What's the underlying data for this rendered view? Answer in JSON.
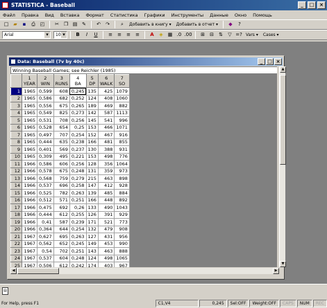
{
  "app": {
    "title": "STATISTICA - Baseball"
  },
  "menu": [
    "Файл",
    "Правка",
    "Вид",
    "Вставка",
    "Формат",
    "Статистика",
    "Графики",
    "Инструменты",
    "Данные",
    "Окно",
    "Помощь"
  ],
  "toolbar1": {
    "add_workbook": "Добавить в книгу ▾",
    "add_report": "Добавить в отчет ▾"
  },
  "toolbar2": {
    "font": "Arial",
    "size": "10",
    "vars": "Vars ▾",
    "cases": "Cases ▾"
  },
  "sheet": {
    "title": "Data: Baseball (7v by 40c)",
    "caption": "Winning Baseball Games; see Reichler (1985)",
    "columns": [
      {
        "num": "1",
        "name": "YEAR"
      },
      {
        "num": "2",
        "name": "WIN"
      },
      {
        "num": "3",
        "name": "RUNS"
      },
      {
        "num": "4",
        "name": "BA"
      },
      {
        "num": "5",
        "name": "DP"
      },
      {
        "num": "6",
        "name": "WALK"
      },
      {
        "num": "7",
        "name": "SO"
      }
    ],
    "rows": [
      [
        "1",
        "1965",
        "0,599",
        "608",
        "0,245",
        "135",
        "425",
        "1079"
      ],
      [
        "2",
        "1965",
        "0,586",
        "682",
        "0,252",
        "124",
        "408",
        "1060"
      ],
      [
        "3",
        "1965",
        "0,556",
        "675",
        "0,265",
        "189",
        "469",
        "882"
      ],
      [
        "4",
        "1965",
        "0,549",
        "825",
        "0,273",
        "142",
        "587",
        "1113"
      ],
      [
        "5",
        "1965",
        "0,531",
        "708",
        "0,256",
        "145",
        "541",
        "996"
      ],
      [
        "6",
        "1965",
        "0,528",
        "654",
        "0,25",
        "153",
        "466",
        "1071"
      ],
      [
        "7",
        "1965",
        "0,497",
        "707",
        "0,254",
        "152",
        "467",
        "916"
      ],
      [
        "8",
        "1965",
        "0,444",
        "635",
        "0,238",
        "166",
        "481",
        "855"
      ],
      [
        "9",
        "1965",
        "0,401",
        "569",
        "0,237",
        "130",
        "388",
        "931"
      ],
      [
        "10",
        "1965",
        "0,309",
        "495",
        "0,221",
        "153",
        "498",
        "776"
      ],
      [
        "11",
        "1966",
        "0,586",
        "606",
        "0,256",
        "128",
        "356",
        "1064"
      ],
      [
        "12",
        "1966",
        "0,578",
        "675",
        "0,248",
        "131",
        "359",
        "973"
      ],
      [
        "13",
        "1966",
        "0,568",
        "759",
        "0,279",
        "215",
        "463",
        "898"
      ],
      [
        "14",
        "1966",
        "0,537",
        "696",
        "0,258",
        "147",
        "412",
        "928"
      ],
      [
        "15",
        "1966",
        "0,525",
        "782",
        "0,263",
        "139",
        "485",
        "884"
      ],
      [
        "16",
        "1966",
        "0,512",
        "571",
        "0,251",
        "166",
        "448",
        "892"
      ],
      [
        "17",
        "1966",
        "0,475",
        "692",
        "0,26",
        "133",
        "490",
        "1043"
      ],
      [
        "18",
        "1966",
        "0,444",
        "612",
        "0,255",
        "126",
        "391",
        "929"
      ],
      [
        "19",
        "1966",
        "0,41",
        "587",
        "0,239",
        "171",
        "521",
        "773"
      ],
      [
        "20",
        "1966",
        "0,364",
        "644",
        "0,254",
        "132",
        "479",
        "908"
      ],
      [
        "21",
        "1967",
        "0,627",
        "695",
        "0,263",
        "127",
        "431",
        "956"
      ],
      [
        "22",
        "1967",
        "0,562",
        "652",
        "0,245",
        "149",
        "453",
        "990"
      ],
      [
        "23",
        "1967",
        "0,54",
        "702",
        "0,251",
        "143",
        "463",
        "888"
      ],
      [
        "24",
        "1967",
        "0,537",
        "604",
        "0,248",
        "124",
        "498",
        "1065"
      ],
      [
        "25",
        "1967",
        "0,506",
        "612",
        "0,242",
        "174",
        "403",
        "967"
      ],
      [
        "26",
        "1967",
        "0,5",
        "679",
        "0,277",
        "186",
        "561",
        "820"
      ]
    ]
  },
  "status": {
    "help": "For Help, press F1",
    "cell": "C1,V4",
    "value": "0,245",
    "sel": "Sel:OFF",
    "weight": "Weight:OFF",
    "caps": "CAPS",
    "num": "NUM",
    "rec": "REC"
  }
}
